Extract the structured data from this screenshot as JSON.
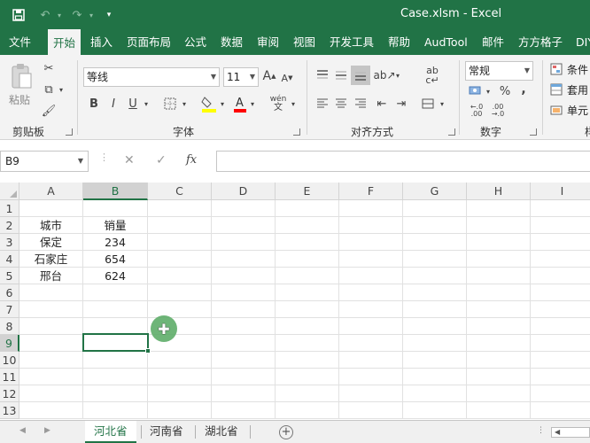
{
  "window": {
    "title": "Case.xlsm  -  Excel",
    "save_icon": "save-icon",
    "undo_icon": "undo-icon",
    "redo_icon": "redo-icon",
    "customize_icon": "customize-qat-icon"
  },
  "menu": {
    "tabs": [
      "文件",
      "开始",
      "插入",
      "页面布局",
      "公式",
      "数据",
      "审阅",
      "视图",
      "开发工具",
      "帮助",
      "AudTool",
      "邮件",
      "方方格子",
      "DIY"
    ],
    "active": "开始"
  },
  "ribbon": {
    "clipboard": {
      "label": "剪贴板",
      "paste": "粘贴"
    },
    "font": {
      "label": "字体",
      "font_name": "等线",
      "font_size": "11",
      "bold": "B",
      "italic": "I",
      "underline": "U",
      "wen": "wén"
    },
    "alignment": {
      "label": "对齐方式"
    },
    "number": {
      "label": "数字",
      "format": "常规",
      "percent": "%",
      "comma": ","
    },
    "styles": {
      "items": [
        "条件",
        "套用",
        "单元"
      ],
      "label": "样"
    }
  },
  "formula_bar": {
    "name_box": "B9",
    "cancel": "✕",
    "enter": "✓",
    "fx": "fx",
    "formula": ""
  },
  "grid": {
    "columns": [
      "A",
      "B",
      "C",
      "D",
      "E",
      "F",
      "G",
      "H",
      "I"
    ],
    "rows": [
      "1",
      "2",
      "3",
      "4",
      "5",
      "6",
      "7",
      "8",
      "9",
      "10",
      "11",
      "12",
      "13"
    ],
    "selected_column": "B",
    "selected_row": "9",
    "cells": {
      "A2": "城市",
      "B2": "销量",
      "A3": "保定",
      "B3": "234",
      "A4": "石家庄",
      "B4": "654",
      "A5": "邢台",
      "B5": "624"
    }
  },
  "sheets": {
    "tabs": [
      "河北省",
      "河南省",
      "湖北省"
    ],
    "active": "河北省",
    "add_label": "+"
  },
  "colors": {
    "excel_green": "#217346",
    "ribbon_bg": "#f3f3f3",
    "header_bg": "#f0f0f0"
  }
}
